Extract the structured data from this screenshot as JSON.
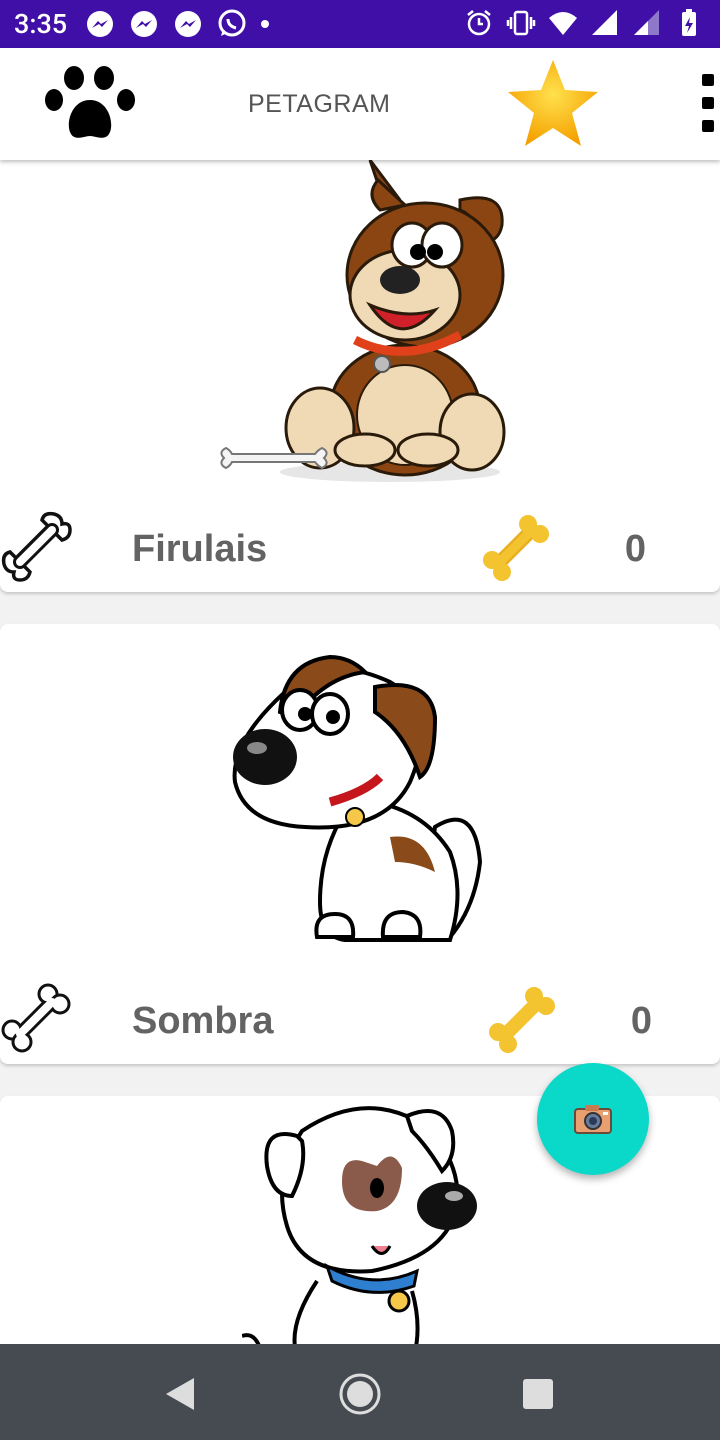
{
  "status_bar": {
    "time": "3:35",
    "left_icons": [
      "messenger-icon",
      "messenger-icon",
      "messenger-icon",
      "whatsapp-icon",
      "notification-dot"
    ],
    "right_icons": [
      "alarm-icon",
      "vibrate-icon",
      "wifi-icon",
      "signal-icon",
      "signal-icon",
      "battery-icon"
    ],
    "color": "#3f0fa8"
  },
  "toolbar": {
    "title": "PETAGRAM",
    "logo_icon": "paw-icon",
    "favorite_icon": "star-icon",
    "menu_icon": "overflow-menu-icon"
  },
  "pets": [
    {
      "name": "Firulais",
      "likes": "0"
    },
    {
      "name": "Sombra",
      "likes": "0"
    },
    {
      "name": "",
      "likes": ""
    }
  ],
  "fab": {
    "icon": "camera-icon",
    "color": "#0ad8c8"
  },
  "nav_bar": {
    "buttons": [
      "back-icon",
      "home-icon",
      "recents-icon"
    ],
    "color": "#454b51"
  }
}
